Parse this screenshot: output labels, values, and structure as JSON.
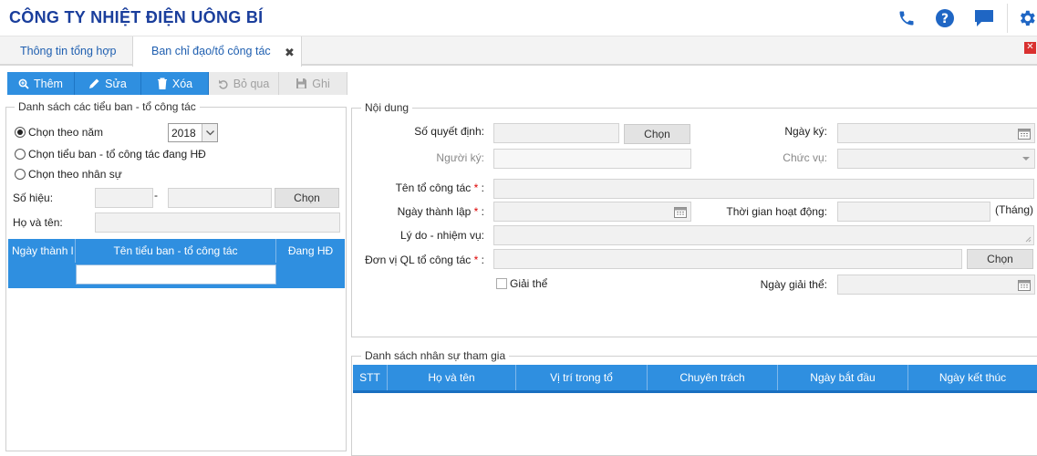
{
  "header": {
    "title": "CÔNG TY NHIỆT ĐIỆN UÔNG BÍ",
    "icons": [
      "phone-icon",
      "help-icon",
      "chat-icon",
      "gear-icon"
    ],
    "brand_color": "#1a3e9c",
    "accent_color": "#2f8fe0"
  },
  "tabs": [
    {
      "label": "Thông tin tổng hợp"
    },
    {
      "label": "Ban chỉ đạo/tổ công tác",
      "close": "✖"
    }
  ],
  "window_close": "✕",
  "toolbar": {
    "add": "Thêm",
    "edit": "Sửa",
    "delete": "Xóa",
    "cancel": "Bỏ qua",
    "save": "Ghi"
  },
  "left": {
    "legend": "Danh sách các tiểu ban - tổ công tác",
    "radio_year": "Chọn theo năm",
    "year_value": "2018",
    "radio_active": "Chọn tiểu ban - tổ công tác đang HĐ",
    "radio_staff": "Chọn theo nhân sự",
    "so_hieu_label": "Số hiệu:",
    "dash": "-",
    "chon": "Chọn",
    "ho_ten_label": "Họ và tên:",
    "grid_headers": [
      "Ngày thành l",
      "Tên tiểu ban - tổ công tác",
      "Đang HĐ"
    ]
  },
  "noidung": {
    "legend": "Nội dung",
    "so_quyet_dinh": "Số quyết định:",
    "chon": "Chọn",
    "ngay_ky": "Ngày ký:",
    "nguoi_ky": "Người ký:",
    "chuc_vu": "Chức vụ:",
    "ten_to": "Tên tổ công tác",
    "ngay_thanh_lap": "Ngày thành lập",
    "thoi_gian": "Thời gian hoạt động:",
    "thang": "(Tháng)",
    "ly_do": "Lý do - nhiệm vụ:",
    "don_vi": "Đơn vị QL tổ công tác",
    "chon2": "Chọn",
    "giai_the": "Giải thể",
    "ngay_giai_the": "Ngày giải thể:",
    "required_mark": "*",
    "colon": ":"
  },
  "staff": {
    "legend": "Danh sách nhân sự tham gia",
    "headers": [
      "STT",
      "Họ và tên",
      "Vị trí trong tổ",
      "Chuyên trách",
      "Ngày bắt đầu",
      "Ngày kết thúc"
    ]
  }
}
